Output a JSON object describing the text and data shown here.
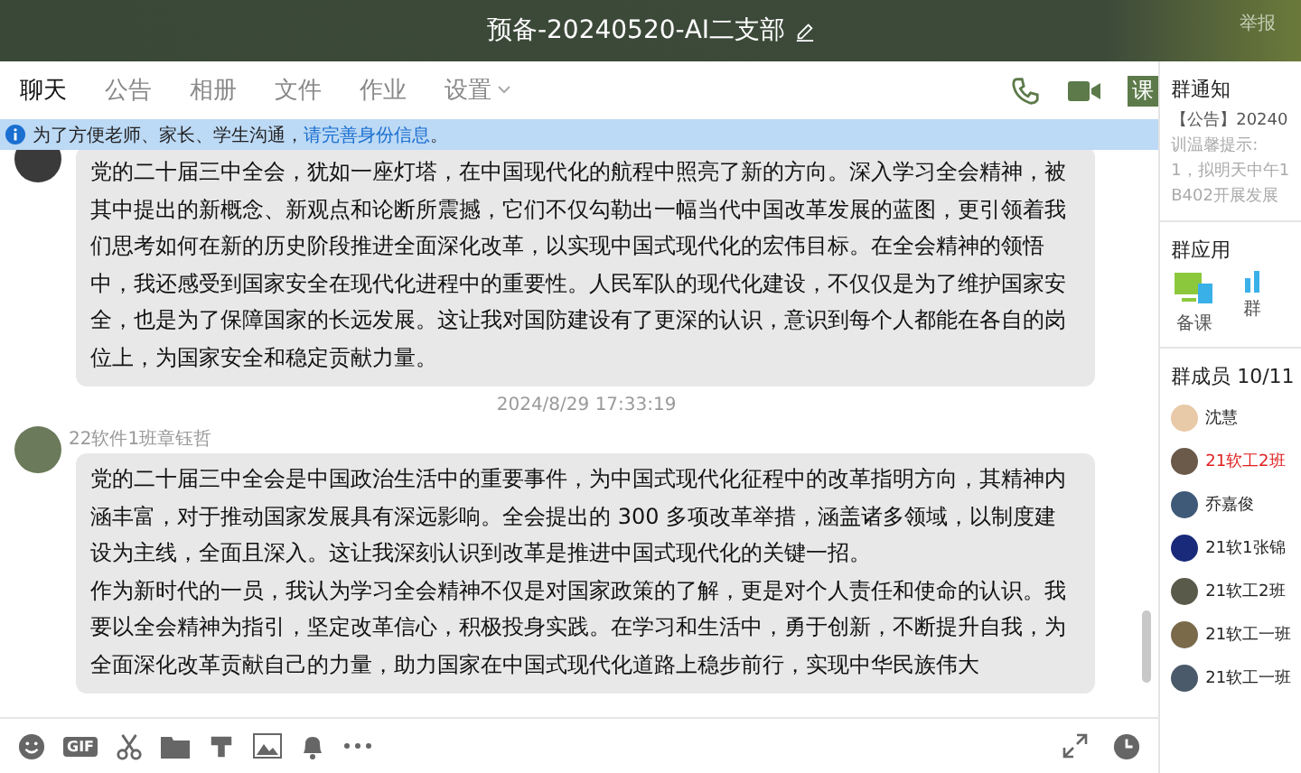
{
  "window": {
    "title": "预备-20240520-AI二支部",
    "report": "举报"
  },
  "tabs": [
    {
      "label": "聊天",
      "selected": true
    },
    {
      "label": "公告",
      "selected": false
    },
    {
      "label": "相册",
      "selected": false
    },
    {
      "label": "文件",
      "selected": false
    },
    {
      "label": "作业",
      "selected": false
    },
    {
      "label": "设置",
      "selected": false,
      "dropdown": true
    }
  ],
  "tab_actions": {
    "course": "课"
  },
  "notice": {
    "text": "为了方便老师、家长、学生沟通，",
    "link": "请完善身份信息",
    "end": "。"
  },
  "messages": [
    {
      "kind": "message",
      "paragraphs": [
        "党的二十届三中全会，犹如一座灯塔，在中国现代化的航程中照亮了新的方向。深入学习全会精神，被其中提出的新概念、新观点和论断所震撼，它们不仅勾勒出一幅当代中国改革发展的蓝图，更引领着我们思考如何在新的历史阶段推进全面深化改革，以实现中国式现代化的宏伟目标。在全会精神的领悟中，我还感受到国家安全在现代化进程中的重要性。人民军队的现代化建设，不仅仅是为了维护国家安全，也是为了保障国家的长远发展。这让我对国防建设有了更深的认识，意识到每个人都能在各自的岗位上，为国家安全和稳定贡献力量。"
      ]
    },
    {
      "kind": "time",
      "text": "2024/8/29 17:33:19"
    },
    {
      "kind": "message",
      "sender": "22软件1班章钰哲",
      "paragraphs": [
        "党的二十届三中全会是中国政治生活中的重要事件，为中国式现代化征程中的改革指明方向，其精神内涵丰富，对于推动国家发展具有深远影响。全会提出的 300 多项改革举措，涵盖诸多领域，以制度建设为主线，全面且深入。这让我深刻认识到改革是推进中国式现代化的关键一招。",
        "作为新时代的一员，我认为学习全会精神不仅是对国家政策的了解，更是对个人责任和使命的认识。我要以全会精神为指引，坚定改革信心，积极投身实践。在学习和生活中，勇于创新，不断提升自我，为全面深化改革贡献自己的力量，助力国家在中国式现代化道路上稳步前行，实现中华民族伟大"
      ]
    }
  ],
  "toolbar": {
    "gif": "GIF"
  },
  "group_notice": {
    "title": "群通知",
    "lines": [
      "【公告】20240",
      "训温馨提示:",
      "1，拟明天中午1",
      "B402开展发展"
    ]
  },
  "group_apps": {
    "title": "群应用",
    "apps": [
      {
        "label": "备课"
      },
      {
        "label": "群"
      }
    ]
  },
  "members": {
    "title": "群成员 10/11",
    "items": [
      {
        "name": "沈慧",
        "color": "#222222"
      },
      {
        "name": "21软工2班",
        "color": "#e02020"
      },
      {
        "name": "乔嘉俊",
        "color": "#222222"
      },
      {
        "name": "21软1张锦",
        "color": "#222222"
      },
      {
        "name": "21软工2班",
        "color": "#222222"
      },
      {
        "name": "21软工一班",
        "color": "#222222"
      },
      {
        "name": "21软工一班",
        "color": "#222222"
      }
    ]
  }
}
